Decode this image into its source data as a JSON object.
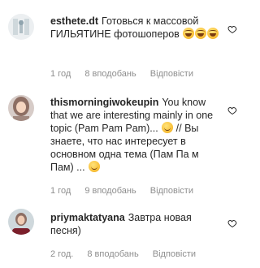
{
  "comments": [
    {
      "username": "esthete.dt",
      "text_part1": "Готовься к массовой ГИЛЬЯТИНЕ фотошоперов",
      "emojis_count": 3,
      "time": "1 год",
      "likes": "8 вподобань",
      "reply": "Відповісти",
      "icon": "heart-icon"
    },
    {
      "username": "thismorningiwokeupin",
      "text_part1": "You know that we are interesting mainly in one topic (Pam Pam Pam)...",
      "text_part2": "// Вы знаете, что нас интересует в основном одна тема (Пам Па м Пам) ...",
      "time": "1 год",
      "likes": "9 вподобань",
      "reply": "Відповісти",
      "icon": "heart-icon"
    },
    {
      "username": "priymaktatyana",
      "text_part1": "Завтра новая песня)",
      "time": "2 год.",
      "likes": "8 вподобань",
      "reply": "Відповісти",
      "icon": "heart-icon"
    }
  ],
  "colors": {
    "text": "#262626",
    "meta": "#8e8e8e",
    "emoji": "#f9c23c"
  }
}
